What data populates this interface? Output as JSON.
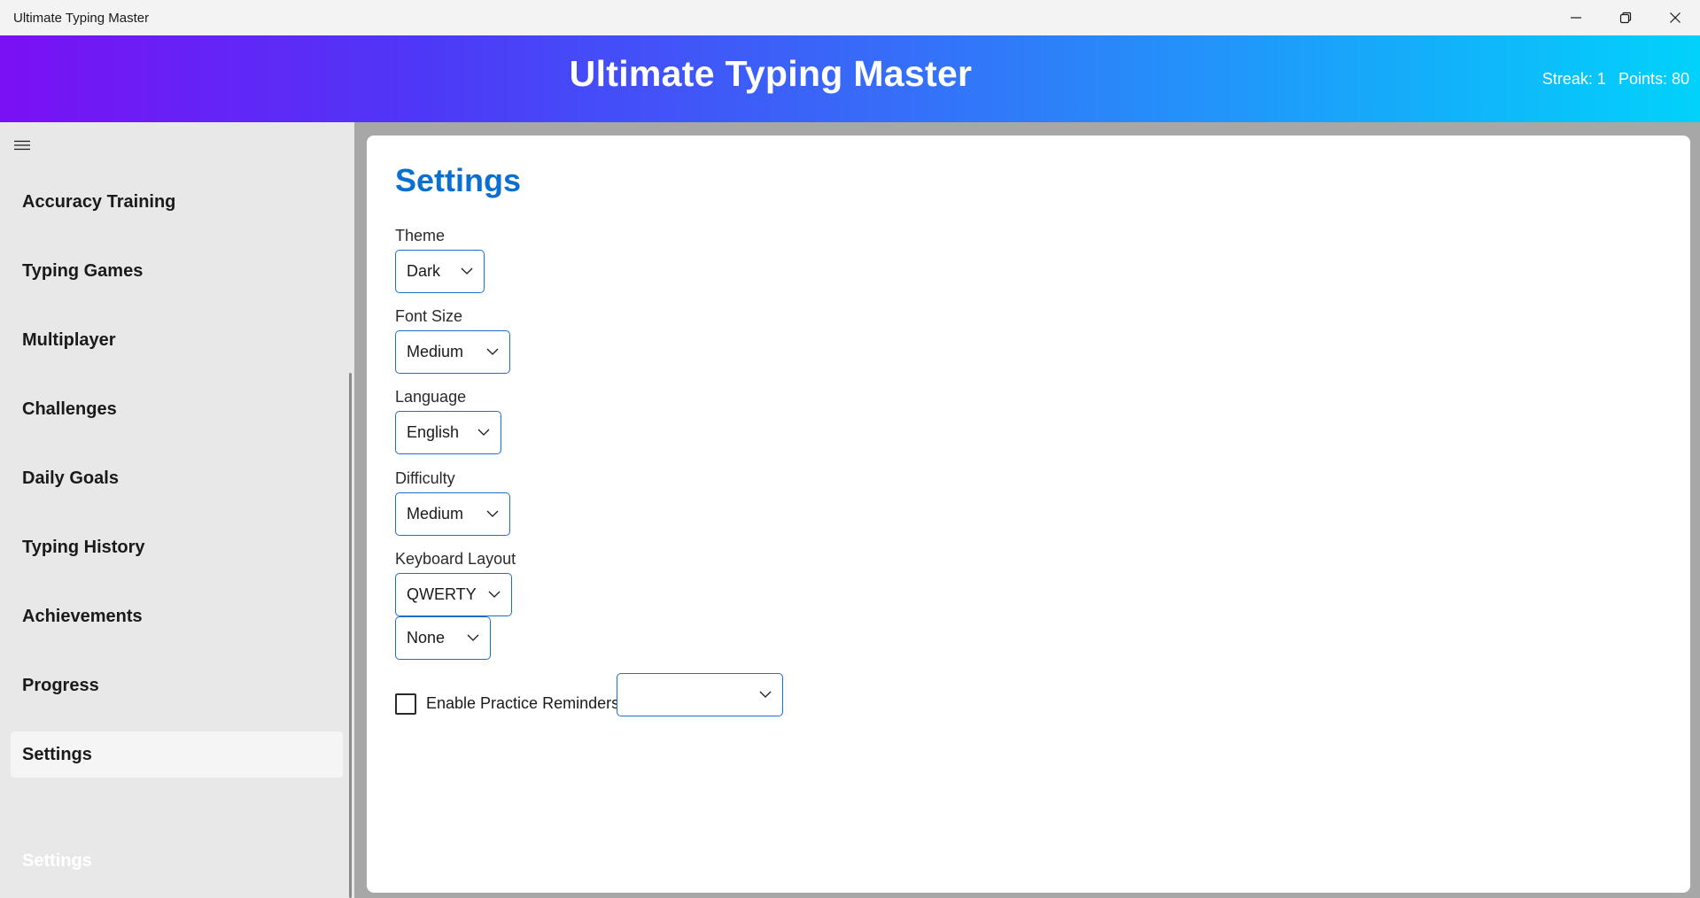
{
  "window": {
    "title": "Ultimate Typing Master",
    "minimize_icon": "minimize-icon",
    "restore_icon": "restore-icon",
    "close_icon": "close-icon"
  },
  "header": {
    "title": "Ultimate Typing Master",
    "streak": "Streak: 1",
    "points": "Points: 80",
    "gradient_colors": [
      "#7a10f4",
      "#4e38f7",
      "#2f7cf9",
      "#01d2fb"
    ]
  },
  "sidebar": {
    "menu_icon": "hamburger-menu-icon",
    "items": [
      {
        "label": "Accuracy Training",
        "active": false
      },
      {
        "label": "Typing Games",
        "active": false
      },
      {
        "label": "Multiplayer",
        "active": false
      },
      {
        "label": "Challenges",
        "active": false
      },
      {
        "label": "Daily Goals",
        "active": false
      },
      {
        "label": "Typing History",
        "active": false
      },
      {
        "label": "Achievements",
        "active": false
      },
      {
        "label": "Progress",
        "active": false
      },
      {
        "label": "Settings",
        "active": true
      }
    ],
    "footer_label": "Settings"
  },
  "settings": {
    "title": "Settings",
    "accent_color": "#0a6fd0",
    "theme": {
      "label": "Theme",
      "value": "Dark"
    },
    "font_size": {
      "label": "Font Size",
      "value": "Medium"
    },
    "language": {
      "label": "Language",
      "value": "English"
    },
    "difficulty": {
      "label": "Difficulty",
      "value": "Medium"
    },
    "keyboard_layout": {
      "label": "Keyboard Layout",
      "value": "QWERTY"
    },
    "extra_combo": {
      "value": "None"
    },
    "reminders": {
      "label": "Enable Practice Reminders",
      "checked": false,
      "time_value": ""
    }
  }
}
